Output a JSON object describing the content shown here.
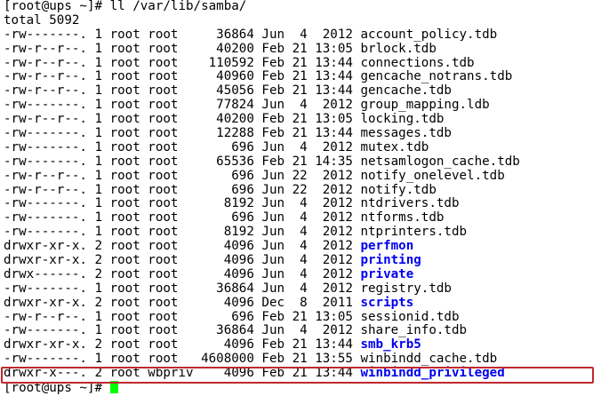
{
  "prompt_command": "[root@ups ~]# ll /var/lib/samba/",
  "total_line": "total 5092",
  "entries": [
    {
      "perms": "-rw-------.",
      "links": "1",
      "owner": "root",
      "group": "root",
      "size": "36864",
      "month": "Jun",
      "day": "4",
      "time": "2012",
      "name": "account_policy.tdb",
      "is_dir": false
    },
    {
      "perms": "-rw-r--r--.",
      "links": "1",
      "owner": "root",
      "group": "root",
      "size": "40200",
      "month": "Feb",
      "day": "21",
      "time": "13:05",
      "name": "brlock.tdb",
      "is_dir": false
    },
    {
      "perms": "-rw-r--r--.",
      "links": "1",
      "owner": "root",
      "group": "root",
      "size": "110592",
      "month": "Feb",
      "day": "21",
      "time": "13:44",
      "name": "connections.tdb",
      "is_dir": false
    },
    {
      "perms": "-rw-r--r--.",
      "links": "1",
      "owner": "root",
      "group": "root",
      "size": "40960",
      "month": "Feb",
      "day": "21",
      "time": "13:44",
      "name": "gencache_notrans.tdb",
      "is_dir": false
    },
    {
      "perms": "-rw-r--r--.",
      "links": "1",
      "owner": "root",
      "group": "root",
      "size": "45056",
      "month": "Feb",
      "day": "21",
      "time": "13:44",
      "name": "gencache.tdb",
      "is_dir": false
    },
    {
      "perms": "-rw-------.",
      "links": "1",
      "owner": "root",
      "group": "root",
      "size": "77824",
      "month": "Jun",
      "day": "4",
      "time": "2012",
      "name": "group_mapping.ldb",
      "is_dir": false
    },
    {
      "perms": "-rw-r--r--.",
      "links": "1",
      "owner": "root",
      "group": "root",
      "size": "40200",
      "month": "Feb",
      "day": "21",
      "time": "13:05",
      "name": "locking.tdb",
      "is_dir": false
    },
    {
      "perms": "-rw-------.",
      "links": "1",
      "owner": "root",
      "group": "root",
      "size": "12288",
      "month": "Feb",
      "day": "21",
      "time": "13:44",
      "name": "messages.tdb",
      "is_dir": false
    },
    {
      "perms": "-rw-------.",
      "links": "1",
      "owner": "root",
      "group": "root",
      "size": "696",
      "month": "Jun",
      "day": "4",
      "time": "2012",
      "name": "mutex.tdb",
      "is_dir": false
    },
    {
      "perms": "-rw-------.",
      "links": "1",
      "owner": "root",
      "group": "root",
      "size": "65536",
      "month": "Feb",
      "day": "21",
      "time": "14:35",
      "name": "netsamlogon_cache.tdb",
      "is_dir": false
    },
    {
      "perms": "-rw-r--r--.",
      "links": "1",
      "owner": "root",
      "group": "root",
      "size": "696",
      "month": "Jun",
      "day": "22",
      "time": "2012",
      "name": "notify_onelevel.tdb",
      "is_dir": false
    },
    {
      "perms": "-rw-r--r--.",
      "links": "1",
      "owner": "root",
      "group": "root",
      "size": "696",
      "month": "Jun",
      "day": "22",
      "time": "2012",
      "name": "notify.tdb",
      "is_dir": false
    },
    {
      "perms": "-rw-------.",
      "links": "1",
      "owner": "root",
      "group": "root",
      "size": "8192",
      "month": "Jun",
      "day": "4",
      "time": "2012",
      "name": "ntdrivers.tdb",
      "is_dir": false
    },
    {
      "perms": "-rw-------.",
      "links": "1",
      "owner": "root",
      "group": "root",
      "size": "696",
      "month": "Jun",
      "day": "4",
      "time": "2012",
      "name": "ntforms.tdb",
      "is_dir": false
    },
    {
      "perms": "-rw-------.",
      "links": "1",
      "owner": "root",
      "group": "root",
      "size": "8192",
      "month": "Jun",
      "day": "4",
      "time": "2012",
      "name": "ntprinters.tdb",
      "is_dir": false
    },
    {
      "perms": "drwxr-xr-x.",
      "links": "2",
      "owner": "root",
      "group": "root",
      "size": "4096",
      "month": "Jun",
      "day": "4",
      "time": "2012",
      "name": "perfmon",
      "is_dir": true
    },
    {
      "perms": "drwxr-xr-x.",
      "links": "2",
      "owner": "root",
      "group": "root",
      "size": "4096",
      "month": "Jun",
      "day": "4",
      "time": "2012",
      "name": "printing",
      "is_dir": true
    },
    {
      "perms": "drwx------.",
      "links": "2",
      "owner": "root",
      "group": "root",
      "size": "4096",
      "month": "Jun",
      "day": "4",
      "time": "2012",
      "name": "private",
      "is_dir": true
    },
    {
      "perms": "-rw-------.",
      "links": "1",
      "owner": "root",
      "group": "root",
      "size": "36864",
      "month": "Jun",
      "day": "4",
      "time": "2012",
      "name": "registry.tdb",
      "is_dir": false
    },
    {
      "perms": "drwxr-xr-x.",
      "links": "2",
      "owner": "root",
      "group": "root",
      "size": "4096",
      "month": "Dec",
      "day": "8",
      "time": "2011",
      "name": "scripts",
      "is_dir": true
    },
    {
      "perms": "-rw-r--r--.",
      "links": "1",
      "owner": "root",
      "group": "root",
      "size": "696",
      "month": "Feb",
      "day": "21",
      "time": "13:05",
      "name": "sessionid.tdb",
      "is_dir": false
    },
    {
      "perms": "-rw-------.",
      "links": "1",
      "owner": "root",
      "group": "root",
      "size": "36864",
      "month": "Jun",
      "day": "4",
      "time": "2012",
      "name": "share_info.tdb",
      "is_dir": false
    },
    {
      "perms": "drwxr-xr-x.",
      "links": "2",
      "owner": "root",
      "group": "root",
      "size": "4096",
      "month": "Feb",
      "day": "21",
      "time": "13:44",
      "name": "smb_krb5",
      "is_dir": true
    },
    {
      "perms": "-rw-------.",
      "links": "1",
      "owner": "root",
      "group": "root",
      "size": "4608000",
      "month": "Feb",
      "day": "21",
      "time": "13:55",
      "name": "winbindd_cache.tdb",
      "is_dir": false
    },
    {
      "perms": "drwxr-x---.",
      "links": "2",
      "owner": "root",
      "group": "wbpriv",
      "size": "4096",
      "month": "Feb",
      "day": "21",
      "time": "13:44",
      "name": "winbindd_privileged",
      "is_dir": true,
      "highlighted": true
    }
  ],
  "final_prompt": "[root@ups ~]# ",
  "colors": {
    "directory": "#0000ee",
    "highlight_border": "#c0282e",
    "cursor": "#00ff00",
    "background": "#ffffff",
    "text": "#000000"
  }
}
